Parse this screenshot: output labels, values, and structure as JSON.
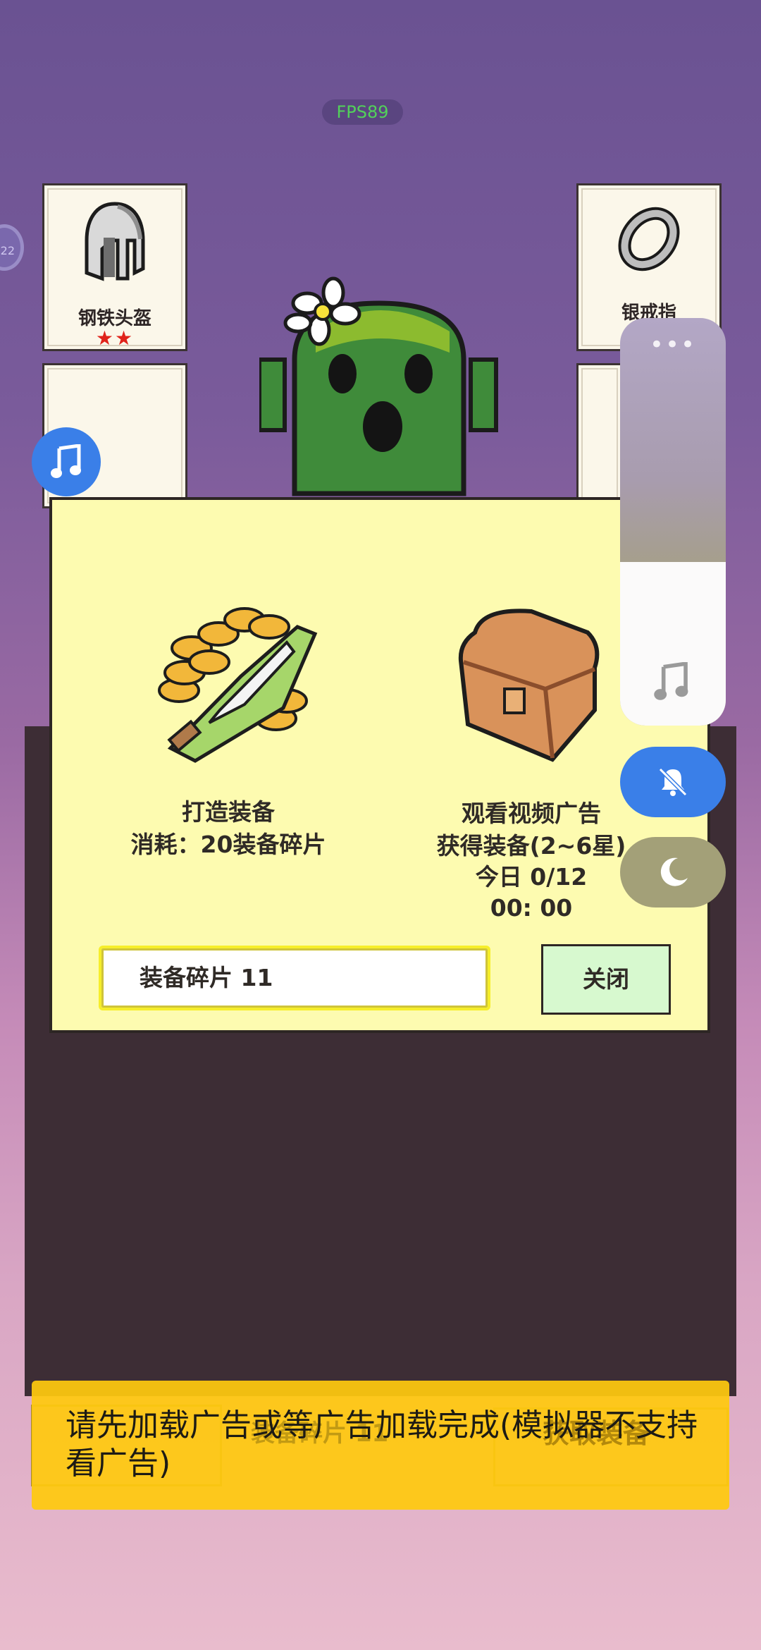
{
  "hud": {
    "fps": "FPS89",
    "edge_bubble": "22"
  },
  "slots": {
    "helmet": {
      "name": "钢铁头盔",
      "stars": "★★"
    },
    "ring": {
      "name": "银戒指"
    }
  },
  "dialog": {
    "craft": {
      "title": "打造装备",
      "cost": "消耗：20装备碎片"
    },
    "ad": {
      "title": "观看视频广告",
      "reward": "获得装备(2~6星)",
      "today": "今日 0/12",
      "timer": "00: 00"
    },
    "shards_label": "装备碎片   11",
    "close_label": "关闭"
  },
  "toast": {
    "message": "请先加载广告或等广告加载完成(模拟器不支持看广告)",
    "underlay_shards": "装备碎片   11",
    "underlay_get": "获取装备"
  },
  "icons": [
    "music-note-icon",
    "more-dots-icon",
    "bell-mute-icon",
    "moon-icon",
    "helmet-icon",
    "ring-icon",
    "sword-coins-icon",
    "treasure-chest-icon",
    "cactus-monster-icon"
  ],
  "colors": {
    "accent_blue": "#3a7fe8",
    "dialog_bg": "#fdfbb0",
    "toast_bg": "#ffc90f",
    "close_bg": "#d7f9cf"
  }
}
